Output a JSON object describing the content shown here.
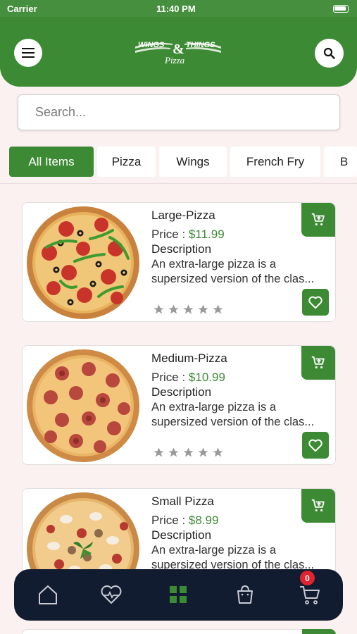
{
  "status_bar": {
    "carrier": "Carrier",
    "time": "11:40 PM"
  },
  "header": {
    "logo_text_left": "WINGS",
    "logo_ampersand": "&",
    "logo_text_right": "THINGS",
    "logo_subtitle": "Pizza",
    "menu_icon": "hamburger-menu-icon",
    "search_icon": "search-icon"
  },
  "search": {
    "placeholder": "Search...",
    "value": ""
  },
  "categories": [
    {
      "label": "All Items",
      "active": true
    },
    {
      "label": "Pizza",
      "active": false
    },
    {
      "label": "Wings",
      "active": false
    },
    {
      "label": "French Fry",
      "active": false
    },
    {
      "label": "B",
      "active": false
    }
  ],
  "products": [
    {
      "name": "Large-Pizza",
      "price_label": "Price :",
      "price": "$11.99",
      "description_label": "Description",
      "description_line1": "An extra-large pizza is a",
      "description_line2": "supersized version of the clas...",
      "rating": 0,
      "max_rating": 5,
      "image": "pepperoni-olive-pepper-pizza"
    },
    {
      "name": "Medium-Pizza",
      "price_label": "Price :",
      "price": "$10.99",
      "description_label": "Description",
      "description_line1": "An extra-large pizza is a",
      "description_line2": "supersized version of the clas...",
      "rating": 0,
      "max_rating": 5,
      "image": "salami-pizza"
    },
    {
      "name": "Small Pizza",
      "price_label": "Price :",
      "price": "$8.99",
      "description_label": "Description",
      "description_line1": "An extra-large pizza is a",
      "description_line2": "supersized version of the clas...",
      "rating": 0,
      "max_rating": 5,
      "image": "mushroom-chicken-basil-pizza"
    }
  ],
  "bottom_nav": {
    "items": [
      "home-icon",
      "heart-icon",
      "grid-icon",
      "bag-icon",
      "cart-icon"
    ],
    "active": "grid-icon",
    "cart_badge": "0"
  },
  "colors": {
    "brand_green": "#3d8a35",
    "price_green": "#3d8a35",
    "nav_background": "#121c30",
    "badge_red": "#e0232f",
    "page_background": "#fbf1f1"
  }
}
